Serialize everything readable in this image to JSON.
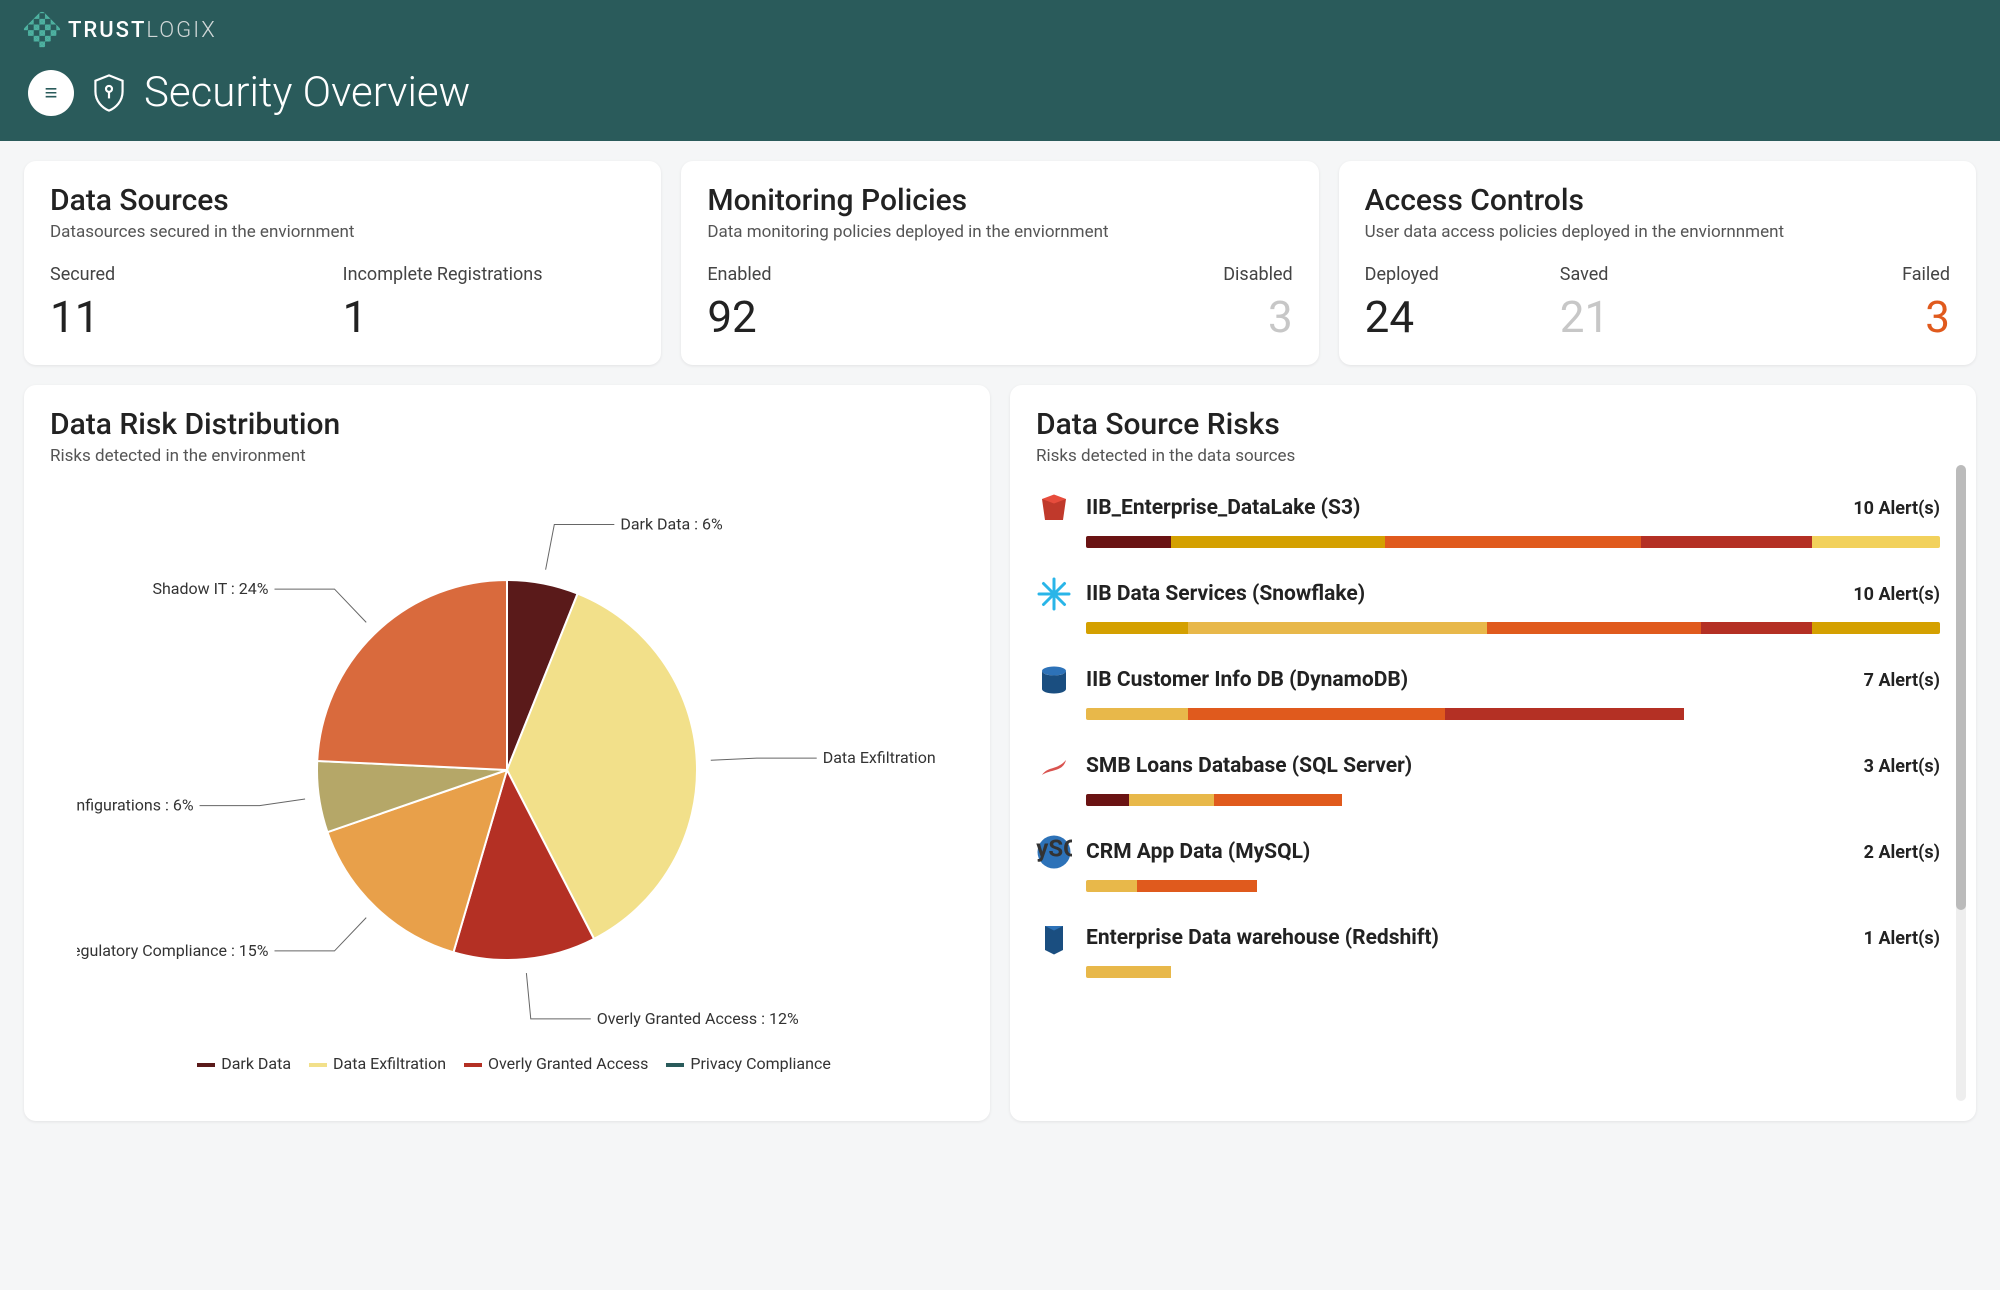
{
  "brand": {
    "name_a": "TRUST",
    "name_b": "LOGIX"
  },
  "page_title": "Security Overview",
  "cards": {
    "datasources": {
      "title": "Data Sources",
      "subtitle": "Datasources secured in the enviornment",
      "m1_label": "Secured",
      "m1_value": "11",
      "m2_label": "Incomplete Registrations",
      "m2_value": "1"
    },
    "monitoring": {
      "title": "Monitoring Policies",
      "subtitle": "Data monitoring policies deployed in the enviornment",
      "m1_label": "Enabled",
      "m1_value": "92",
      "m2_label": "Disabled",
      "m2_value": "3"
    },
    "access": {
      "title": "Access Controls",
      "subtitle": "User data access policies deployed in the enviornnment",
      "m1_label": "Deployed",
      "m1_value": "24",
      "m2_label": "Saved",
      "m2_value": "21",
      "m3_label": "Failed",
      "m3_value": "3"
    }
  },
  "risk_distribution": {
    "title": "Data Risk Distribution",
    "subtitle": "Risks detected in the environment"
  },
  "risk_sources": {
    "title": "Data Source Risks",
    "subtitle": "Risks detected in the data sources",
    "items": [
      {
        "name": "IIB_Enterprise_DataLake (S3)",
        "alerts": "10 Alert(s)",
        "icon": "s3",
        "bar": [
          [
            "#6a1313",
            10
          ],
          [
            "#d4a000",
            25
          ],
          [
            "#e05a1d",
            30
          ],
          [
            "#b43024",
            20
          ],
          [
            "#f2d15c",
            15
          ]
        ]
      },
      {
        "name": "IIB Data Services (Snowflake)",
        "alerts": "10 Alert(s)",
        "icon": "snowflake",
        "bar": [
          [
            "#d4a000",
            12
          ],
          [
            "#e8b84a",
            35
          ],
          [
            "#e05a1d",
            25
          ],
          [
            "#b43024",
            13
          ],
          [
            "#d4a000",
            15
          ]
        ]
      },
      {
        "name": "IIB Customer Info DB (DynamoDB)",
        "alerts": "7 Alert(s)",
        "icon": "dynamodb",
        "bar": [
          [
            "#e8b84a",
            12
          ],
          [
            "#e05a1d",
            30
          ],
          [
            "#b43024",
            28
          ]
        ]
      },
      {
        "name": "SMB Loans Database (SQL Server)",
        "alerts": "3 Alert(s)",
        "icon": "sqlserver",
        "bar": [
          [
            "#6a1313",
            5
          ],
          [
            "#e8b84a",
            10
          ],
          [
            "#e05a1d",
            15
          ]
        ]
      },
      {
        "name": "CRM App Data (MySQL)",
        "alerts": "2 Alert(s)",
        "icon": "mysql",
        "bar": [
          [
            "#e8b84a",
            6
          ],
          [
            "#e05a1d",
            14
          ]
        ]
      },
      {
        "name": "Enterprise Data warehouse (Redshift)",
        "alerts": "1 Alert(s)",
        "icon": "redshift",
        "bar": [
          [
            "#e8b84a",
            10
          ]
        ]
      }
    ]
  },
  "chart_data": {
    "type": "pie",
    "title": "Data Risk Distribution",
    "series": [
      {
        "name": "Dark Data",
        "value": 6,
        "color": "#5a1a1a"
      },
      {
        "name": "Data Exfiltration",
        "value": 36,
        "color": "#f2e08a"
      },
      {
        "name": "Overly Granted Access",
        "value": 12,
        "color": "#b43024"
      },
      {
        "name": "Regulatory Compliance",
        "value": 15,
        "color": "#e8a04a"
      },
      {
        "name": "Misconfigurations",
        "value": 6,
        "color": "#b5a768"
      },
      {
        "name": "Shadow IT",
        "value": 24,
        "color": "#d96a3d"
      }
    ],
    "legend_extra": [
      "Privacy Compliance"
    ]
  },
  "legend_labels": {
    "a": "Dark Data",
    "b": "Data Exfiltration",
    "c": "Overly Granted Access",
    "d": "Privacy Compliance"
  }
}
